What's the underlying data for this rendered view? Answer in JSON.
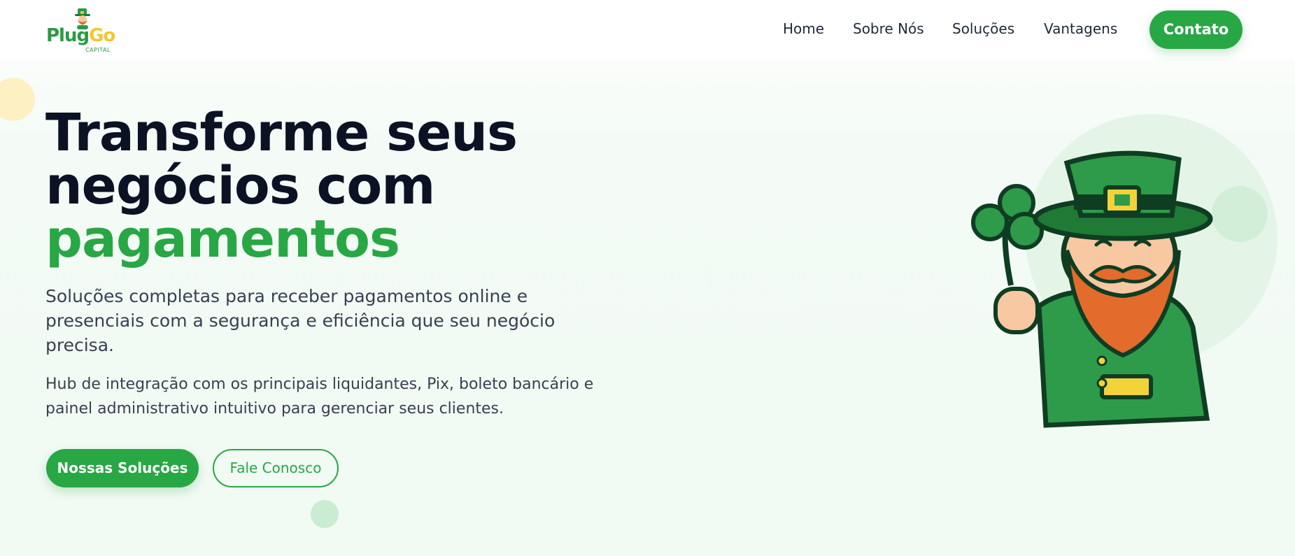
{
  "brand": {
    "name_part1": "Plug",
    "name_part2": "Go",
    "subtitle": "CAPITAL"
  },
  "nav": {
    "items": [
      {
        "label": "Home"
      },
      {
        "label": "Sobre Nós"
      },
      {
        "label": "Soluções"
      },
      {
        "label": "Vantagens"
      }
    ],
    "cta_label": "Contato"
  },
  "hero": {
    "title_line1": "Transforme seus",
    "title_line2": "negócios com",
    "title_accent": "pagamentos",
    "lead": "Soluções completas para receber pagamentos online e presenciais com a segurança e eficiência que seu negócio precisa.",
    "sub": "Hub de integração com os principais liquidantes, Pix, boleto bancário e painel administrativo intuitivo para gerenciar seus clientes.",
    "primary_button": "Nossas Soluções",
    "secondary_button": "Fale Conosco"
  },
  "illustration": {
    "icon": "leprechaun-mascot-icon"
  },
  "colors": {
    "brand_green": "#28a745",
    "brand_yellow": "#f3c62f",
    "heading": "#0b1224",
    "body_text": "#374151"
  }
}
